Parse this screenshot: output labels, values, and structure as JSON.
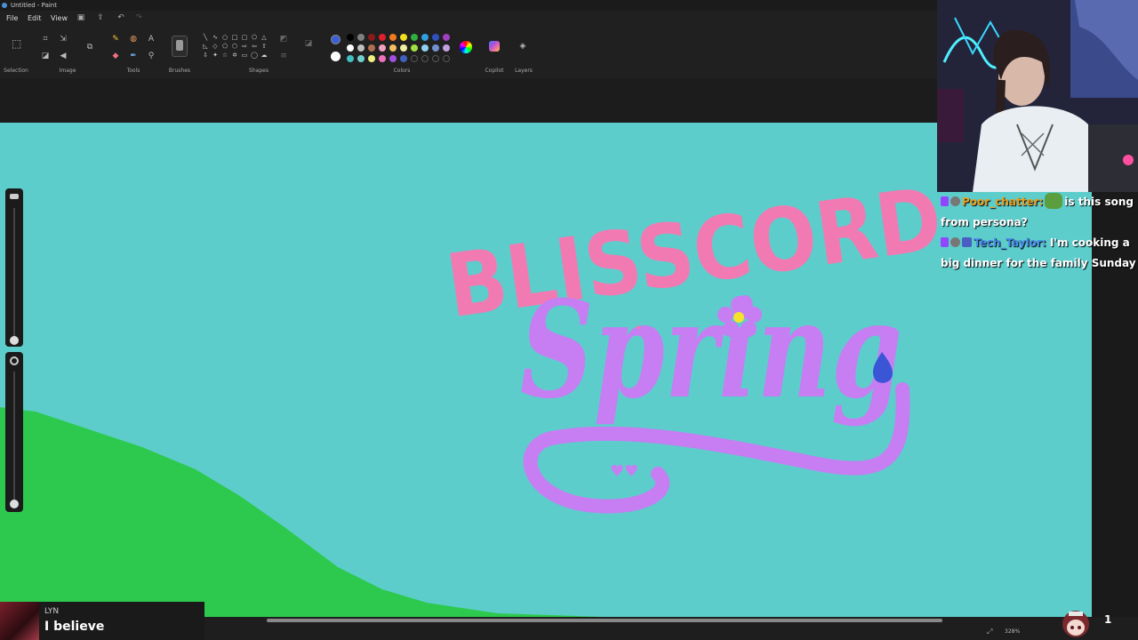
{
  "window": {
    "title": "Untitled - Paint"
  },
  "menu": {
    "file": "File",
    "edit": "Edit",
    "view": "View"
  },
  "ribbon": {
    "selection_label": "Selection",
    "image_label": "Image",
    "tools_label": "Tools",
    "brushes_label": "Brushes",
    "shapes_label": "Shapes",
    "colors_label": "Colors",
    "copilot_label": "Copilot",
    "layers_label": "Layers",
    "primary_color": "#3a5fd8",
    "secondary_color": "#ffffff",
    "palette_row1": [
      "#000000",
      "#808080",
      "#8b1a1a",
      "#e0202a",
      "#f07a20",
      "#f0e020",
      "#30b040",
      "#30a0e0",
      "#3050c0",
      "#a040c0"
    ],
    "palette_row2": [
      "#ffffff",
      "#c0c0c0",
      "#b07050",
      "#f0a0c0",
      "#f0c060",
      "#f0f0a0",
      "#a0e040",
      "#90d0f0",
      "#7090d0",
      "#c0a0e0"
    ],
    "palette_row3": [
      "#40c0c0",
      "#70d0d0",
      "#f0f080",
      "#f070c0",
      "#a050e0",
      "#4060c0",
      "",
      "",
      "",
      ""
    ]
  },
  "canvas": {
    "background": "#5dcdcc",
    "hill_color": "#2dc94f",
    "title_line1": "BLISSCORD",
    "title_line1_color": "#f27ab2",
    "title_line2": "Spring",
    "title_line2_color": "#c67ef2"
  },
  "status": {
    "zoom": "328%"
  },
  "chat": {
    "messages": [
      {
        "user": "Poor_chatter:",
        "user_color": "#e8a020",
        "text": "is this song from persona?"
      },
      {
        "user": "Tech_Taylor:",
        "user_color": "#4a8ef0",
        "text": "I'm cooking a big dinner for the family Sunday"
      }
    ]
  },
  "alert": {
    "name": "LYN",
    "message": "I believe"
  },
  "viewers": {
    "count": "1"
  }
}
